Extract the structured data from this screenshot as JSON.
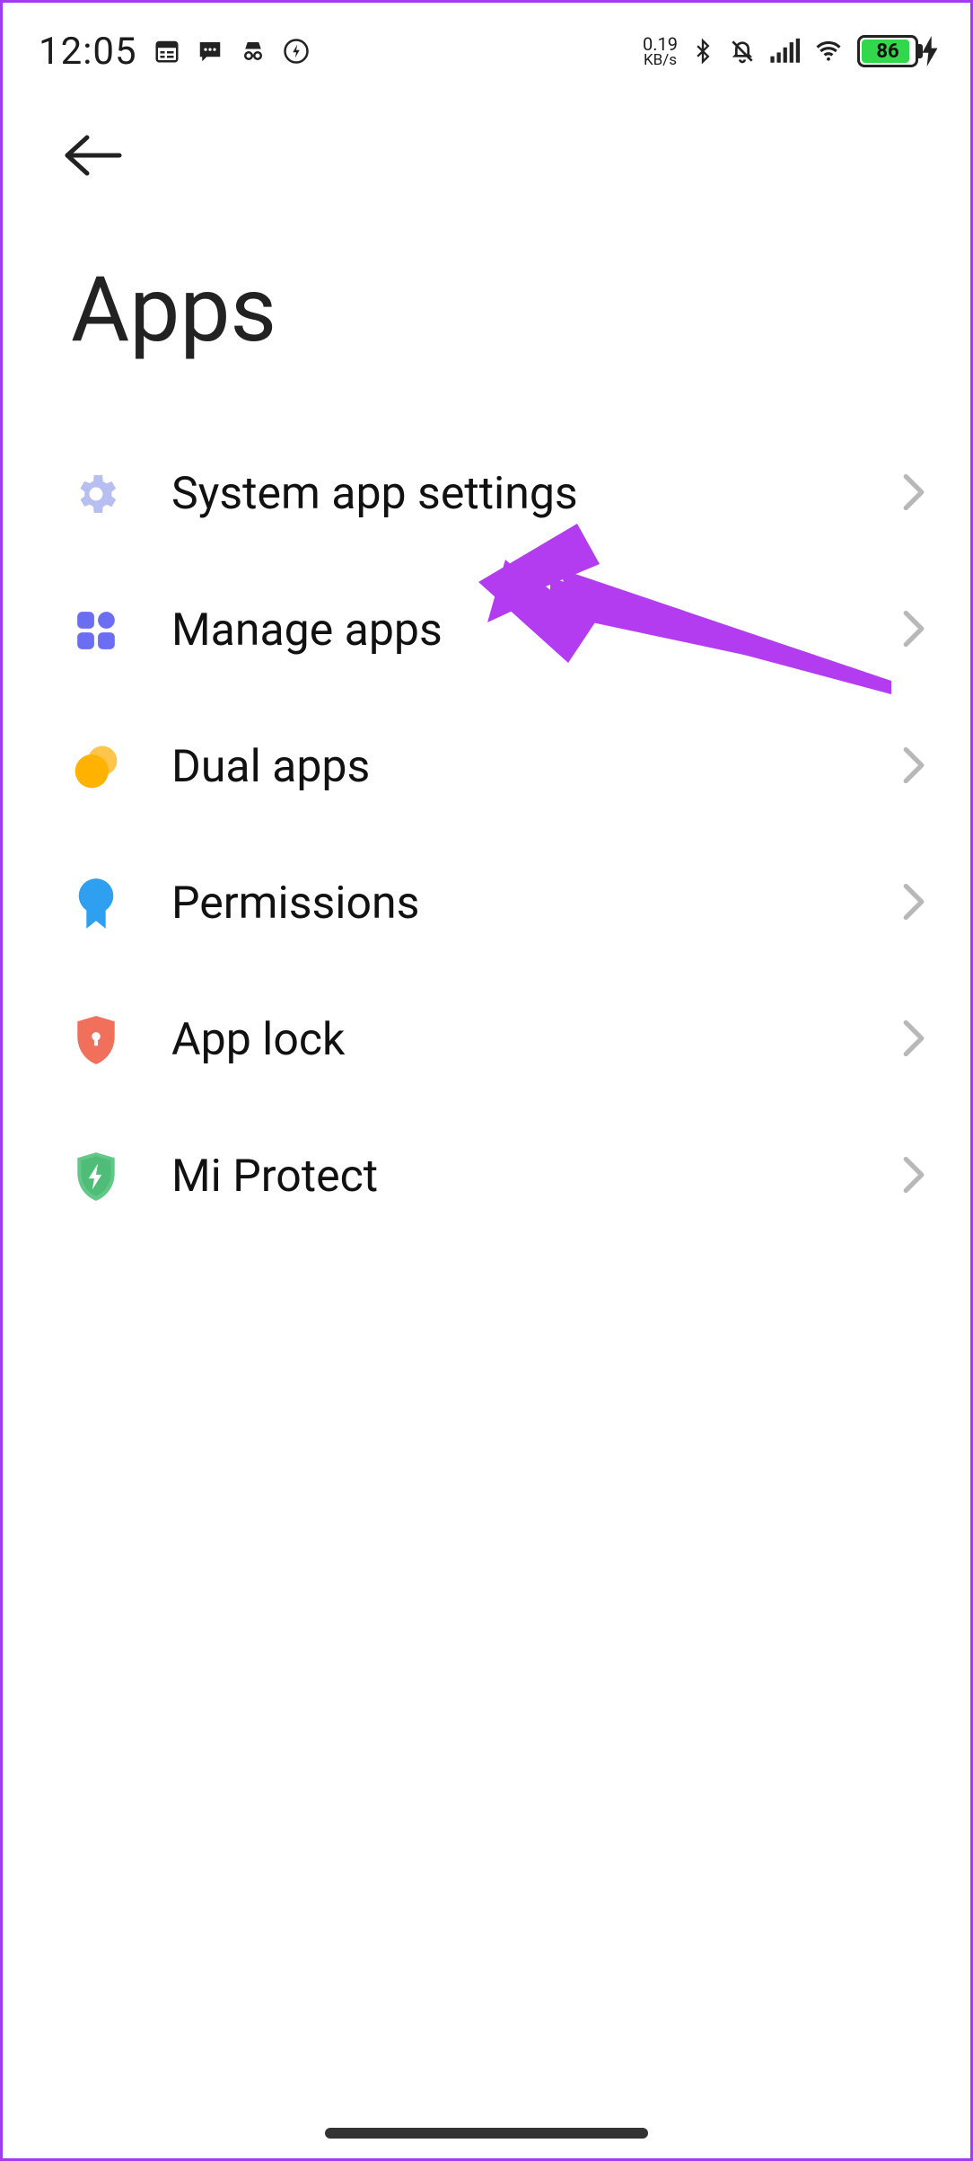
{
  "status": {
    "time": "12:05",
    "net_speed_value": "0.19",
    "net_speed_unit": "KB/s",
    "battery_text": "86"
  },
  "page": {
    "title": "Apps"
  },
  "list": {
    "items": [
      {
        "id": "system-app-settings",
        "label": "System app settings"
      },
      {
        "id": "manage-apps",
        "label": "Manage apps"
      },
      {
        "id": "dual-apps",
        "label": "Dual apps"
      },
      {
        "id": "permissions",
        "label": "Permissions"
      },
      {
        "id": "app-lock",
        "label": "App lock"
      },
      {
        "id": "mi-protect",
        "label": "Mi Protect"
      }
    ]
  },
  "annotation": {
    "target": "manage-apps",
    "color": "#b33cf0"
  }
}
